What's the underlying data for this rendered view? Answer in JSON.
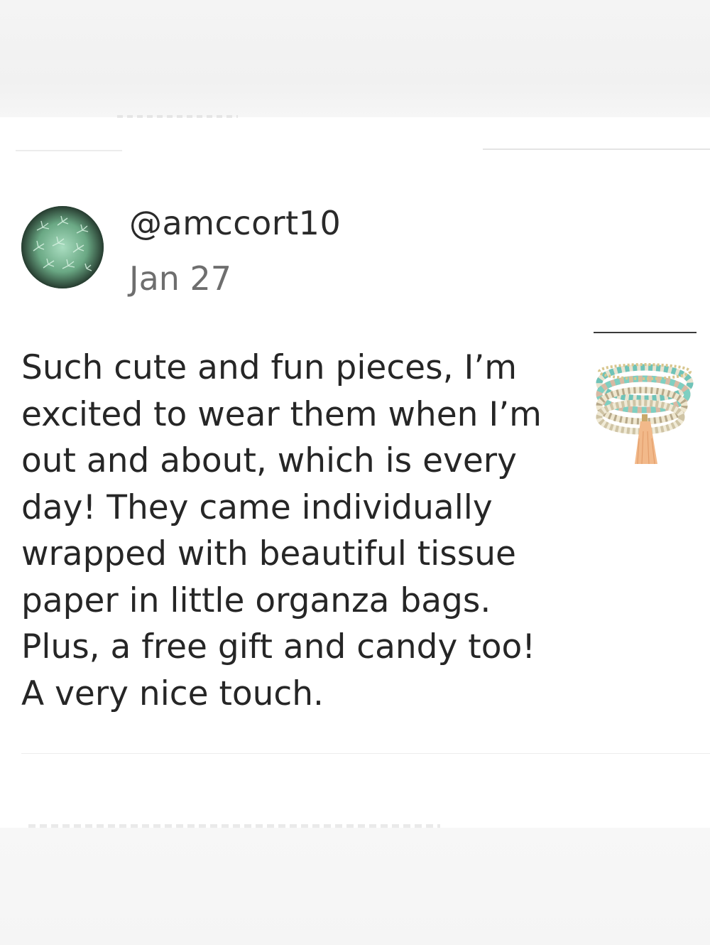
{
  "review": {
    "username": "@amccort10",
    "date": "Jan 27",
    "text": "Such cute and fun pieces, I’m\nexcited to wear them when I’m\nout and about, which is every\nday!  They came individually\nwrapped with beautiful tissue\npaper in little organza bags.\nPlus, a free gift and candy too!\nA very nice touch.",
    "avatar_icon": "succulent-avatar",
    "thumbnail_icon": "beaded-bracelet-stack"
  },
  "colors": {
    "text": "#262626",
    "date": "#6e6e6e",
    "divider": "#ececec",
    "bracelet_teal": "#6fc3b8",
    "tassel": "#f2b98a"
  }
}
